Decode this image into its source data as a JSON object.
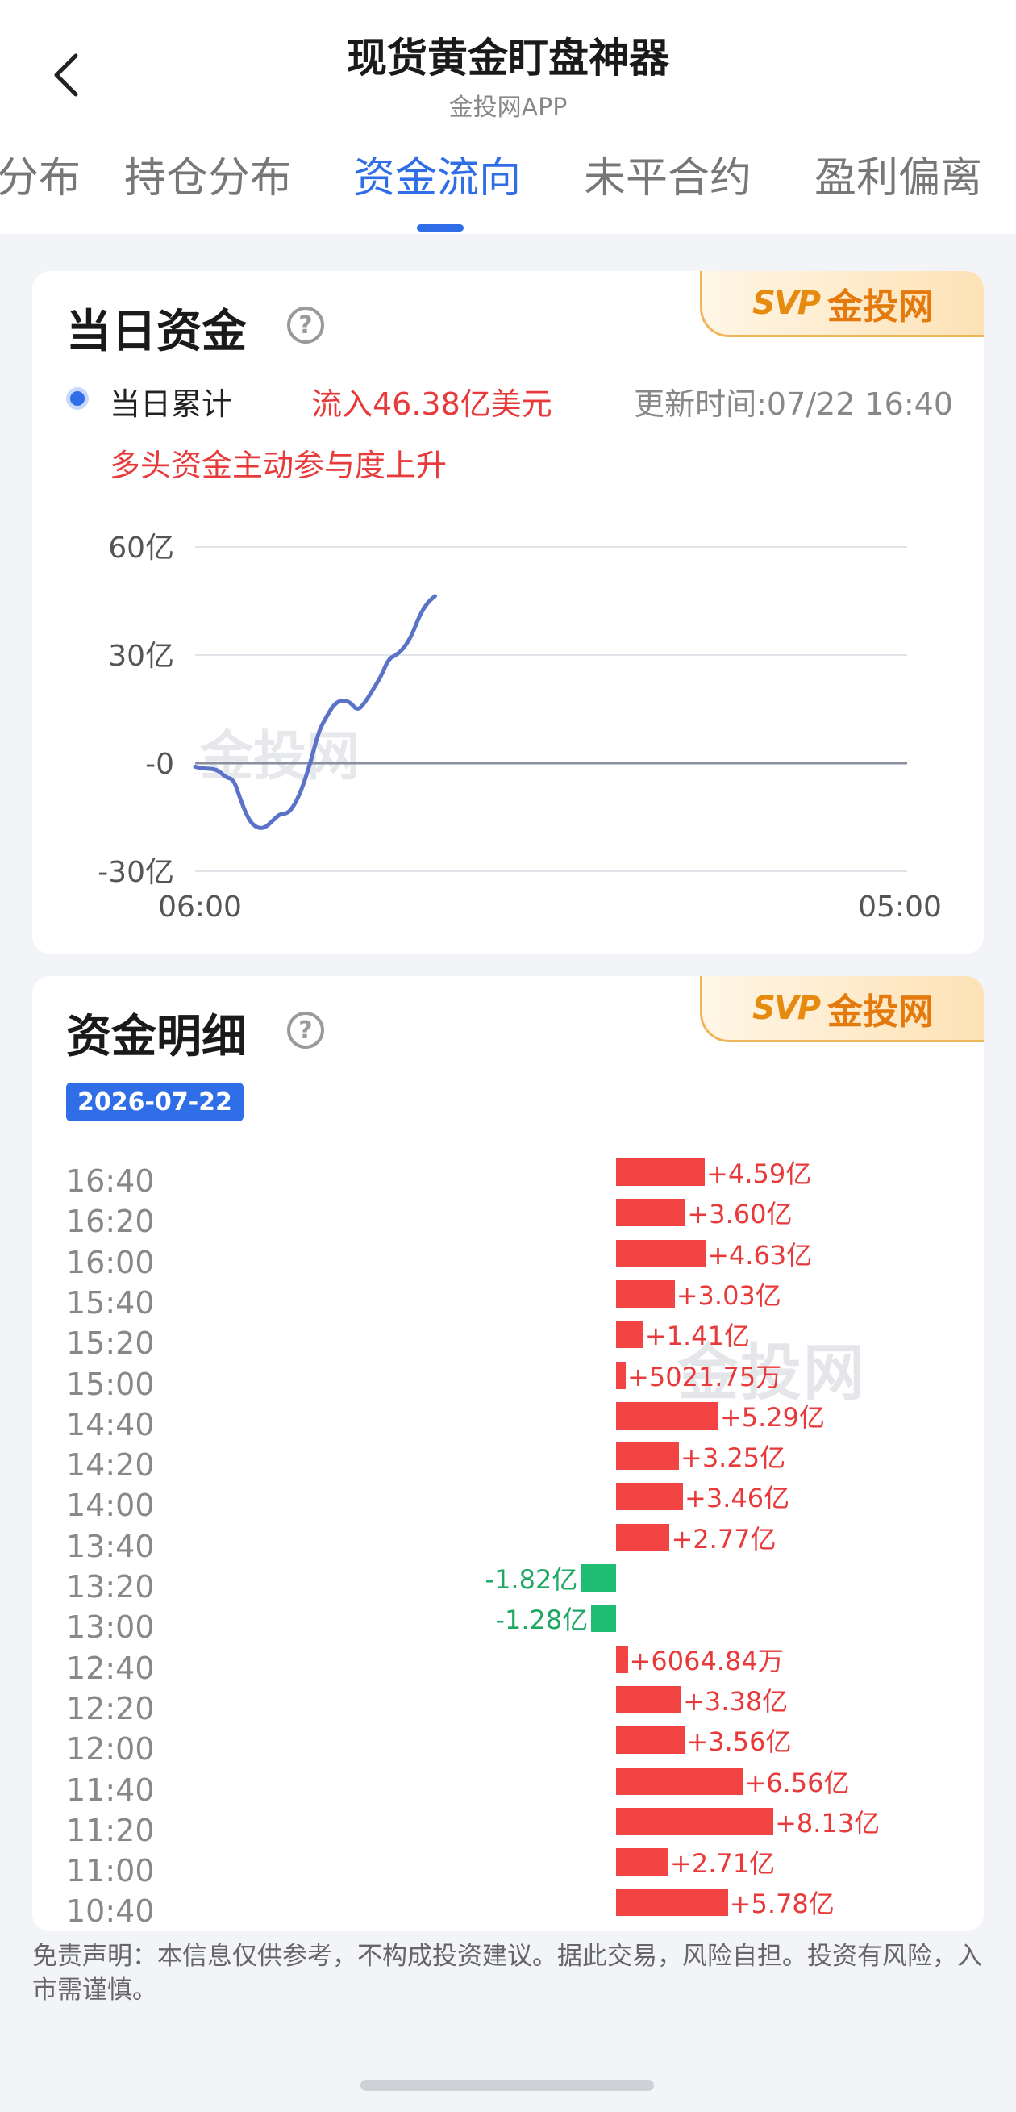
{
  "header": {
    "title": "现货黄金盯盘神器",
    "subtitle": "金投网APP"
  },
  "tabs": [
    {
      "label": "分布",
      "active": false
    },
    {
      "label": "持仓分布",
      "active": false
    },
    {
      "label": "资金流向",
      "active": true
    },
    {
      "label": "未平合约",
      "active": false
    },
    {
      "label": "盈利偏离",
      "active": false
    }
  ],
  "brand_badge": "金投网",
  "daily": {
    "title": "当日资金",
    "legend_label": "当日累计",
    "inflow_text": "流入46.38亿美元",
    "update_time": "更新时间:07/22 16:40",
    "trend_text": "多头资金主动参与度上升"
  },
  "chart_data": {
    "type": "line",
    "x_ticks": [
      "06:00",
      "05:00"
    ],
    "y_ticks": [
      "60亿",
      "30亿",
      "-0",
      "-30亿"
    ],
    "ylim": [
      -30,
      60
    ],
    "x_range_hours": [
      0,
      23
    ],
    "series": [
      {
        "color": "#5a73c8",
        "points": [
          [
            0.0,
            -1
          ],
          [
            0.25,
            -1.5
          ],
          [
            0.5,
            -1.5
          ],
          [
            0.75,
            -2
          ],
          [
            1.0,
            -4
          ],
          [
            1.25,
            -4.5
          ],
          [
            1.5,
            -11
          ],
          [
            1.75,
            -16
          ],
          [
            2.0,
            -18
          ],
          [
            2.25,
            -18
          ],
          [
            2.5,
            -16
          ],
          [
            2.75,
            -14
          ],
          [
            3.0,
            -14
          ],
          [
            3.25,
            -11
          ],
          [
            3.5,
            -6
          ],
          [
            3.75,
            1
          ],
          [
            4.0,
            9
          ],
          [
            4.25,
            13
          ],
          [
            4.5,
            16.5
          ],
          [
            4.75,
            17.5
          ],
          [
            5.0,
            17
          ],
          [
            5.25,
            14.5
          ],
          [
            5.5,
            17
          ],
          [
            5.75,
            20.5
          ],
          [
            6.0,
            24
          ],
          [
            6.25,
            29
          ],
          [
            6.5,
            30
          ],
          [
            6.75,
            32
          ],
          [
            7.0,
            35.5
          ],
          [
            7.25,
            41
          ],
          [
            7.5,
            44.5
          ],
          [
            7.75,
            46.38
          ]
        ]
      }
    ]
  },
  "detail": {
    "title": "资金明细",
    "date": "2026-07-22",
    "rows": [
      {
        "time": "16:40",
        "value": 4.59,
        "label": "+4.59亿"
      },
      {
        "time": "16:20",
        "value": 3.6,
        "label": "+3.60亿"
      },
      {
        "time": "16:00",
        "value": 4.63,
        "label": "+4.63亿"
      },
      {
        "time": "15:40",
        "value": 3.03,
        "label": "+3.03亿"
      },
      {
        "time": "15:20",
        "value": 1.41,
        "label": "+1.41亿"
      },
      {
        "time": "15:00",
        "value": 0.502175,
        "label": "+5021.75万"
      },
      {
        "time": "14:40",
        "value": 5.29,
        "label": "+5.29亿"
      },
      {
        "time": "14:20",
        "value": 3.25,
        "label": "+3.25亿"
      },
      {
        "time": "14:00",
        "value": 3.46,
        "label": "+3.46亿"
      },
      {
        "time": "13:40",
        "value": 2.77,
        "label": "+2.77亿"
      },
      {
        "time": "13:20",
        "value": -1.82,
        "label": "-1.82亿"
      },
      {
        "time": "13:00",
        "value": -1.28,
        "label": "-1.28亿"
      },
      {
        "time": "12:40",
        "value": 0.606484,
        "label": "+6064.84万"
      },
      {
        "time": "12:20",
        "value": 3.38,
        "label": "+3.38亿"
      },
      {
        "time": "12:00",
        "value": 3.56,
        "label": "+3.56亿"
      },
      {
        "time": "11:40",
        "value": 6.56,
        "label": "+6.56亿"
      },
      {
        "time": "11:20",
        "value": 8.13,
        "label": "+8.13亿"
      },
      {
        "time": "11:00",
        "value": 2.71,
        "label": "+2.71亿"
      },
      {
        "time": "10:40",
        "value": 5.78,
        "label": "+5.78亿"
      }
    ]
  },
  "disclaimer": "免责声明：本信息仅供参考，不构成投资建议。据此交易，风险自担。投资有风险，入市需谨慎。",
  "colors": {
    "accent": "#2f6ee6",
    "positive": "#f34444",
    "negative": "#1ebd72",
    "line": "#5a73c8"
  }
}
